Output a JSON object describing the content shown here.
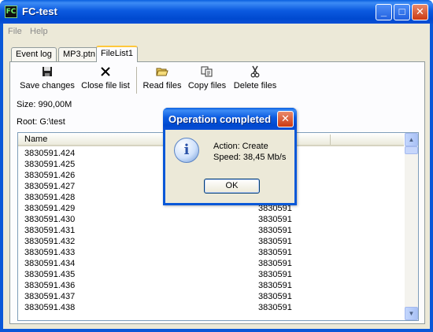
{
  "window": {
    "title": "FC-test",
    "icon_text": "FC",
    "minimize_glyph": "_",
    "maximize_glyph": "□",
    "close_glyph": "✕"
  },
  "menu": {
    "items": [
      "File",
      "Help"
    ]
  },
  "tabs": [
    {
      "label": "Event log",
      "active": false
    },
    {
      "label": "MP3.ptn",
      "active": false
    },
    {
      "label": "FileList1",
      "active": true
    }
  ],
  "toolbar": {
    "save_label": "Save changes",
    "save_icon": "floppy-disk",
    "close_label": "Close file list",
    "close_icon": "x-mark",
    "read_label": "Read files",
    "read_icon": "open-folder",
    "copy_label": "Copy files",
    "copy_icon": "copy-pages",
    "delete_label": "Delete files",
    "delete_icon": "scissors"
  },
  "info": {
    "size": "Size: 990,00M",
    "root": "Root: G:\\test"
  },
  "list": {
    "columns": [
      "Name",
      "",
      ""
    ],
    "rows": [
      {
        "name": "3830591.424",
        "size": ""
      },
      {
        "name": "3830591.425",
        "size": ""
      },
      {
        "name": "3830591.426",
        "size": ""
      },
      {
        "name": "3830591.427",
        "size": ""
      },
      {
        "name": "3830591.428",
        "size": ""
      },
      {
        "name": "3830591.429",
        "size": "3830591"
      },
      {
        "name": "3830591.430",
        "size": "3830591"
      },
      {
        "name": "3830591.431",
        "size": "3830591"
      },
      {
        "name": "3830591.432",
        "size": "3830591"
      },
      {
        "name": "3830591.433",
        "size": "3830591"
      },
      {
        "name": "3830591.434",
        "size": "3830591"
      },
      {
        "name": "3830591.435",
        "size": "3830591"
      },
      {
        "name": "3830591.436",
        "size": "3830591"
      },
      {
        "name": "3830591.437",
        "size": "3830591"
      },
      {
        "name": "3830591.438",
        "size": "3830591"
      }
    ]
  },
  "dialog": {
    "title": "Operation completed",
    "icon": "information-icon",
    "line1": "Action: Create",
    "line2": "Speed: 38,45 Mb/s",
    "ok_label": "OK"
  },
  "colors": {
    "titlebar": "#0a58d8",
    "client_bg": "#ece9d8",
    "active_tab_accent": "#ffc83c",
    "close_button": "#cc3a12"
  }
}
